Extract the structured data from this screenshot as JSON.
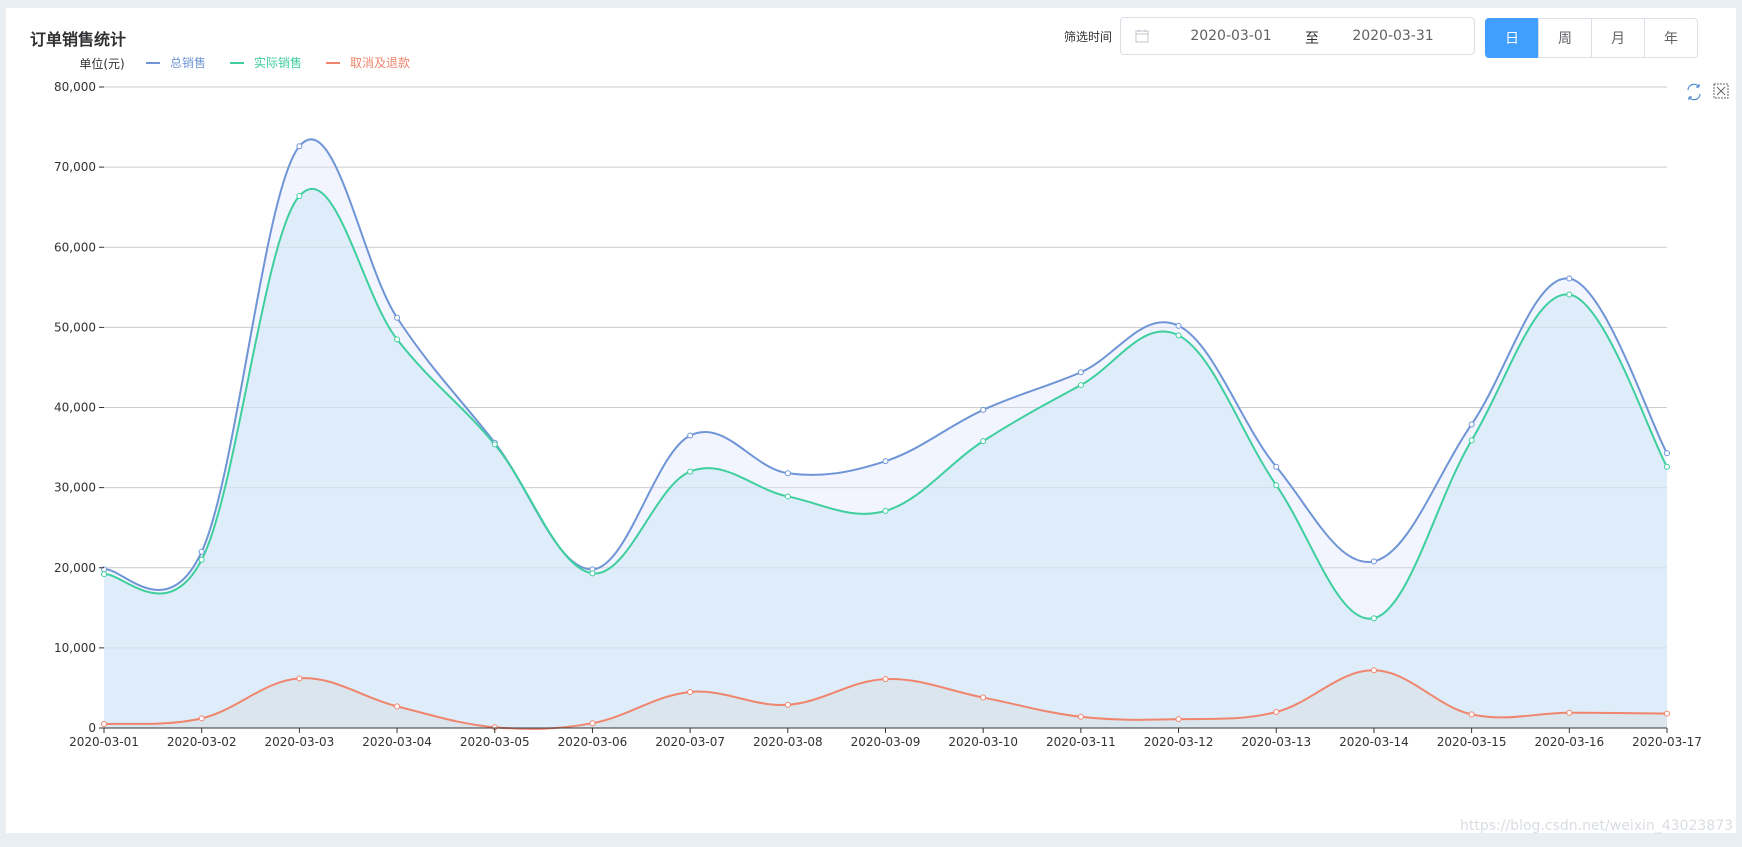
{
  "header": {
    "title": "订单销售统计",
    "filter_label": "筛选时间",
    "start_date": "2020-03-01",
    "range_separator": "至",
    "end_date": "2020-03-31",
    "period_buttons": [
      "日",
      "周",
      "月",
      "年"
    ],
    "active_period": "日"
  },
  "toolbox": {
    "icons": [
      "restore-icon",
      "data-zoom-reset-icon"
    ]
  },
  "watermark": "https://blog.csdn.net/weixin_43023873",
  "colors": {
    "total": "#6f95d6",
    "actual": "#3fcf9e",
    "refund": "#f0856e",
    "accent": "#409eff"
  },
  "chart_data": {
    "type": "area",
    "ylabel": "单位(元)",
    "ylim": [
      0,
      80000
    ],
    "y_ticks": [
      "0",
      "10,000",
      "20,000",
      "30,000",
      "40,000",
      "50,000",
      "60,000",
      "70,000",
      "80,000"
    ],
    "grid": true,
    "legend_position": "top-left",
    "x": [
      "2020-03-01",
      "2020-03-02",
      "2020-03-03",
      "2020-03-04",
      "2020-03-05",
      "2020-03-06",
      "2020-03-07",
      "2020-03-08",
      "2020-03-09",
      "2020-03-10",
      "2020-03-11",
      "2020-03-12",
      "2020-03-13",
      "2020-03-14",
      "2020-03-15",
      "2020-03-16",
      "2020-03-17"
    ],
    "series": [
      {
        "name": "总销售",
        "color_key": "total",
        "values": [
          19800,
          22000,
          72600,
          51200,
          35600,
          19800,
          36500,
          31800,
          33300,
          39700,
          44400,
          50200,
          32600,
          20800,
          37900,
          56100,
          34300
        ]
      },
      {
        "name": "实际销售",
        "color_key": "actual",
        "values": [
          19200,
          21000,
          66400,
          48500,
          35400,
          19300,
          32000,
          28900,
          27100,
          35800,
          42800,
          49000,
          30300,
          13700,
          35900,
          54100,
          32600
        ]
      },
      {
        "name": "取消及退款",
        "color_key": "refund",
        "values": [
          500,
          1200,
          6200,
          2700,
          100,
          600,
          4500,
          2900,
          6100,
          3800,
          1400,
          1100,
          2000,
          7200,
          1700,
          1900,
          1800
        ]
      }
    ]
  }
}
